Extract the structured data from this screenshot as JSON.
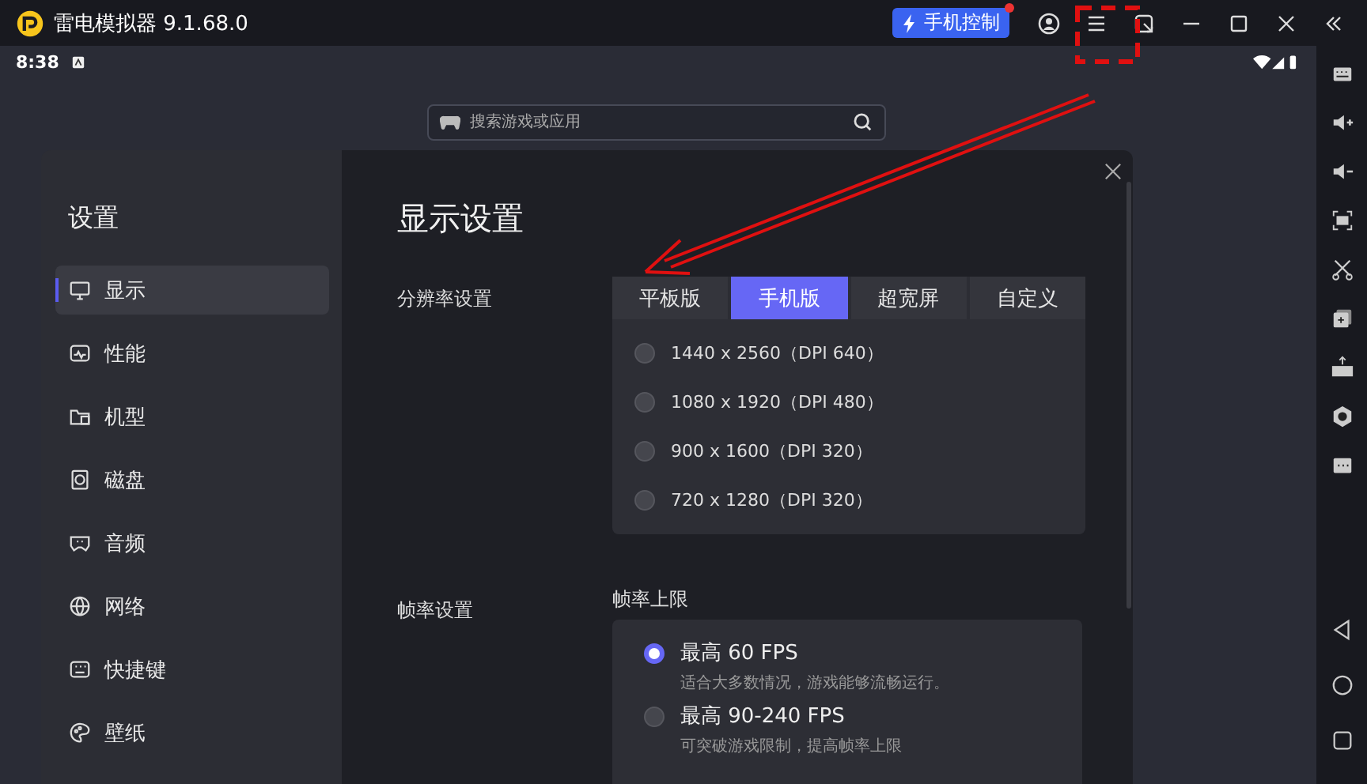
{
  "window": {
    "title": "雷电模拟器 9.1.68.0"
  },
  "phone_control": {
    "label": "手机控制",
    "notification": true
  },
  "status_bar": {
    "time": "8:38"
  },
  "search": {
    "placeholder": "搜索游戏或应用"
  },
  "settings": {
    "title": "设置",
    "sidebar": [
      {
        "kind": "display",
        "label": "显示",
        "selected": true
      },
      {
        "kind": "performance",
        "label": "性能",
        "selected": false
      },
      {
        "kind": "model",
        "label": "机型",
        "selected": false
      },
      {
        "kind": "disk",
        "label": "磁盘",
        "selected": false
      },
      {
        "kind": "audio",
        "label": "音频",
        "selected": false
      },
      {
        "kind": "network",
        "label": "网络",
        "selected": false
      },
      {
        "kind": "shortcut",
        "label": "快捷键",
        "selected": false
      },
      {
        "kind": "wallpaper",
        "label": "壁纸",
        "selected": false
      }
    ],
    "heading": "显示设置",
    "resolution": {
      "label": "分辨率设置",
      "tabs": [
        {
          "label": "平板版",
          "selected": false
        },
        {
          "label": "手机版",
          "selected": true
        },
        {
          "label": "超宽屏",
          "selected": false
        },
        {
          "label": "自定义",
          "selected": false
        }
      ],
      "options": [
        {
          "label": "1440 x 2560（DPI 640）",
          "selected": false
        },
        {
          "label": "1080 x 1920（DPI 480）",
          "selected": false
        },
        {
          "label": "900 x 1600（DPI 320）",
          "selected": false
        },
        {
          "label": "720 x 1280（DPI 320）",
          "selected": false
        }
      ]
    },
    "frame_rate": {
      "label": "帧率设置",
      "sublabel": "帧率上限",
      "options": [
        {
          "label": "最高 60 FPS",
          "description": "适合大多数情况，游戏能够流畅运行。",
          "selected": true
        },
        {
          "label": "最高 90-240 FPS",
          "description": "可突破游戏限制，提高帧率上限",
          "selected": false
        }
      ]
    }
  }
}
